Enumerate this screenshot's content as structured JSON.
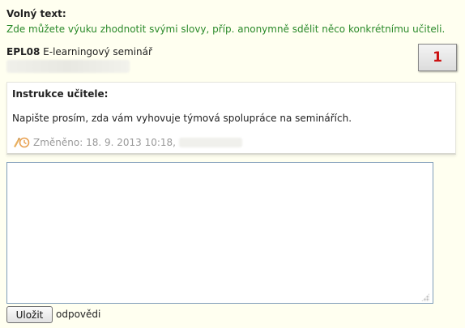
{
  "section": {
    "heading": "Volný text:",
    "hint": "Zde můžete výuku zhodnotit svými slovy, příp. anonymně sdělit něco konkrétnímu učiteli."
  },
  "course": {
    "code": "EPL08",
    "name": "E-learningový seminář"
  },
  "badge": {
    "number": "1",
    "color": "#cc1111"
  },
  "instructions": {
    "title": "Instrukce učitele:",
    "body": "Napište prosím, zda vám vyhovuje týmová spolupráce na seminářích.",
    "modified": "Změněno: 18. 9. 2013 10:18,",
    "icon": "edit-history-icon"
  },
  "answer": {
    "value": "",
    "placeholder": ""
  },
  "actions": {
    "save_label": "Uložit",
    "after_label": "odpovědi"
  },
  "colors": {
    "background": "#fffff0",
    "hint": "#2a8a2a",
    "meta": "#999999",
    "input_border": "#7f9db9"
  }
}
